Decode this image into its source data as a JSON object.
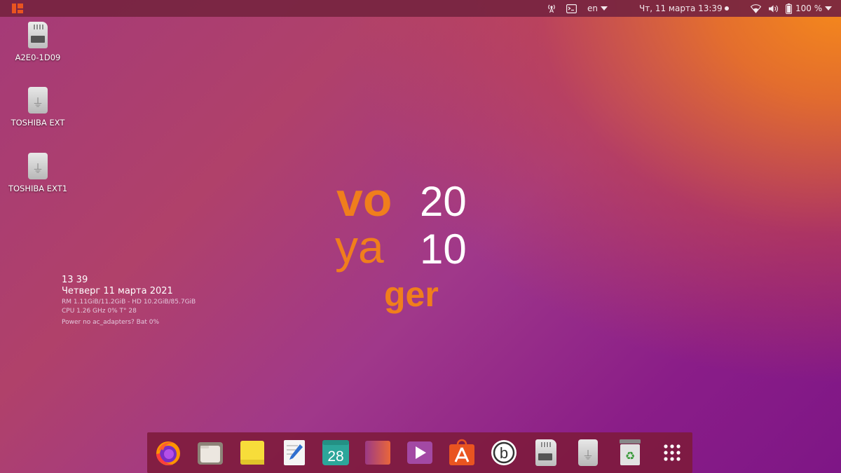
{
  "top_panel": {
    "keyboard_layout": "en",
    "clock": "Чт, 11 марта  13:39",
    "battery_percent": "100 %",
    "icons": [
      "activities-icon",
      "network-antenna-icon",
      "terminal-indicator-icon",
      "notification-dot-icon",
      "wifi-icon",
      "volume-icon",
      "battery-icon"
    ]
  },
  "desktop_icons": [
    {
      "label": "A2E0-1D09",
      "icon": "sd-card-icon"
    },
    {
      "label": "TOSHIBA EXT",
      "icon": "usb-drive-icon"
    },
    {
      "label": "TOSHIBA EXT1",
      "icon": "usb-drive-icon"
    }
  ],
  "conky": {
    "time": "13 39",
    "date": "Четверг 11 марта 2021",
    "memory": "RM 1.11GiB/11.2GiB - HD 10.2GiB/85.7GiB",
    "cpu": "CPU 1.26 GHz 0% T° 28",
    "power": "Power no ac_adapters? Bat 0%"
  },
  "logo": {
    "word_lines": [
      "vo",
      "ya",
      "ger"
    ],
    "year_lines": [
      "20",
      "10"
    ],
    "orange": "#f07e1c"
  },
  "dock": {
    "calendar_day": "28",
    "apps": [
      "firefox-icon",
      "files-icon",
      "notes-icon",
      "text-editor-icon",
      "calendar-icon",
      "app-gradient-icon",
      "video-player-icon",
      "app-store-icon",
      "b-app-icon",
      "sd-card-icon",
      "usb-drive-icon",
      "trash-icon",
      "app-grid-icon"
    ]
  },
  "colors": {
    "accent": "#e95420",
    "panel": "#76243f",
    "dock": "#7d1a3a"
  }
}
